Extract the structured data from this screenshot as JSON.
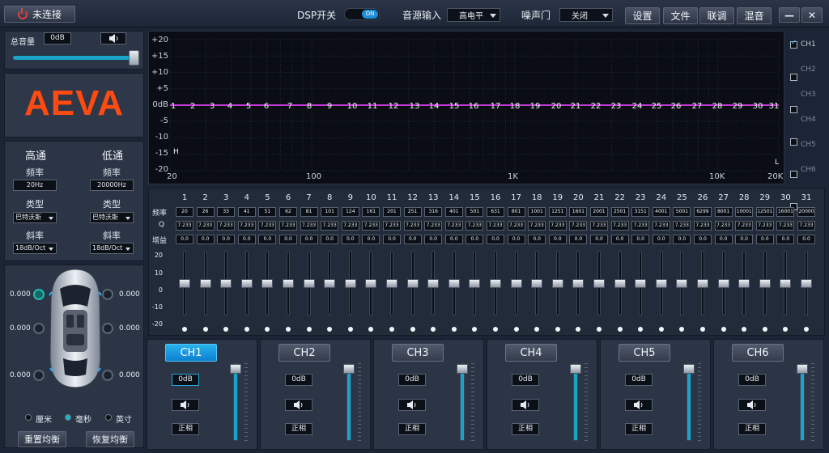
{
  "topbar": {
    "connect": "未连接",
    "dsp_label": "DSP开关",
    "dsp_toggle": "ON",
    "src_label": "音源输入",
    "src_value": "高电平",
    "gate_label": "噪声门",
    "gate_value": "关闭",
    "buttons": [
      "设置",
      "文件",
      "联调",
      "混音"
    ],
    "min": "—",
    "close": "✕"
  },
  "volume": {
    "label": "总音量",
    "value": "0dB",
    "level": 0.95
  },
  "logo": "AEVA",
  "crossover": {
    "high": {
      "title": "高通",
      "freq_label": "频率",
      "freq": "20Hz",
      "type_label": "类型",
      "type": "巴特沃斯",
      "slope_label": "斜率",
      "slope": "18dB/Oct"
    },
    "low": {
      "title": "低通",
      "freq_label": "频率",
      "freq": "20000Hz",
      "type_label": "类型",
      "type": "巴特沃斯",
      "slope_label": "斜率",
      "slope": "18dB/Oct"
    }
  },
  "speakers": {
    "left": [
      "0.000",
      "0.000",
      "0.000"
    ],
    "right": [
      "0.000",
      "0.000",
      "0.000"
    ],
    "units": [
      "厘米",
      "毫秒",
      "英寸"
    ],
    "unit_selected": 1,
    "reset": "重置均衡",
    "restore": "恢复均衡"
  },
  "graph": {
    "y_labels": [
      "+20",
      "+15",
      "+10",
      "+5",
      "0dB",
      "-5",
      "-10",
      "-15",
      "-20"
    ],
    "x_labels": [
      "20",
      "100",
      "1K",
      "10K",
      "20K"
    ],
    "band_markers": [
      "1",
      "2",
      "3",
      "4",
      "5",
      "6",
      "7",
      "8",
      "9",
      "10",
      "11",
      "12",
      "13",
      "14",
      "15",
      "16",
      "17",
      "18",
      "19",
      "20",
      "21",
      "22",
      "23",
      "24",
      "25",
      "26",
      "27",
      "28",
      "29",
      "30",
      "31"
    ],
    "hp_marker": "H",
    "lp_marker": "L"
  },
  "channel_list": [
    {
      "label": "CH1",
      "checked": true
    },
    {
      "label": "CH2",
      "checked": false
    },
    {
      "label": "CH3",
      "checked": false
    },
    {
      "label": "CH4",
      "checked": false
    },
    {
      "label": "CH5",
      "checked": false
    },
    {
      "label": "CH6",
      "checked": false
    }
  ],
  "eq": {
    "row_labels": {
      "freq": "频率",
      "q": "Q",
      "gain": "增益"
    },
    "scale": [
      "20",
      "10",
      "0",
      "-10",
      "-20"
    ],
    "bands": [
      {
        "n": "1",
        "f": "20",
        "q": "7.233",
        "g": "0.0"
      },
      {
        "n": "2",
        "f": "26",
        "q": "7.233",
        "g": "0.0"
      },
      {
        "n": "3",
        "f": "33",
        "q": "7.233",
        "g": "0.0"
      },
      {
        "n": "4",
        "f": "41",
        "q": "7.233",
        "g": "0.0"
      },
      {
        "n": "5",
        "f": "51",
        "q": "7.233",
        "g": "0.0"
      },
      {
        "n": "6",
        "f": "62",
        "q": "7.233",
        "g": "0.0"
      },
      {
        "n": "7",
        "f": "81",
        "q": "7.233",
        "g": "0.0"
      },
      {
        "n": "8",
        "f": "101",
        "q": "7.233",
        "g": "0.0"
      },
      {
        "n": "9",
        "f": "124",
        "q": "7.233",
        "g": "0.0"
      },
      {
        "n": "10",
        "f": "161",
        "q": "7.233",
        "g": "0.0"
      },
      {
        "n": "11",
        "f": "201",
        "q": "7.233",
        "g": "0.0"
      },
      {
        "n": "12",
        "f": "251",
        "q": "7.233",
        "g": "0.0"
      },
      {
        "n": "13",
        "f": "316",
        "q": "7.233",
        "g": "0.0"
      },
      {
        "n": "14",
        "f": "401",
        "q": "7.233",
        "g": "0.0"
      },
      {
        "n": "15",
        "f": "501",
        "q": "7.233",
        "g": "0.0"
      },
      {
        "n": "16",
        "f": "631",
        "q": "7.233",
        "g": "0.0"
      },
      {
        "n": "17",
        "f": "801",
        "q": "7.233",
        "g": "0.0"
      },
      {
        "n": "18",
        "f": "1001",
        "q": "7.233",
        "g": "0.0"
      },
      {
        "n": "19",
        "f": "1251",
        "q": "7.233",
        "g": "0.0"
      },
      {
        "n": "20",
        "f": "1601",
        "q": "7.233",
        "g": "0.0"
      },
      {
        "n": "21",
        "f": "2001",
        "q": "7.233",
        "g": "0.0"
      },
      {
        "n": "22",
        "f": "2501",
        "q": "7.233",
        "g": "0.0"
      },
      {
        "n": "23",
        "f": "3151",
        "q": "7.233",
        "g": "0.0"
      },
      {
        "n": "24",
        "f": "4001",
        "q": "7.233",
        "g": "0.0"
      },
      {
        "n": "25",
        "f": "5001",
        "q": "7.233",
        "g": "0.0"
      },
      {
        "n": "26",
        "f": "6299",
        "q": "7.233",
        "g": "0.0"
      },
      {
        "n": "27",
        "f": "8001",
        "q": "7.233",
        "g": "0.0"
      },
      {
        "n": "28",
        "f": "10001",
        "q": "7.233",
        "g": "0.0"
      },
      {
        "n": "29",
        "f": "12501",
        "q": "7.233",
        "g": "0.0"
      },
      {
        "n": "30",
        "f": "16001",
        "q": "7.233",
        "g": "0.0"
      },
      {
        "n": "31",
        "f": "20000",
        "q": "7.233",
        "g": "0.0"
      }
    ]
  },
  "channels": [
    {
      "label": "CH1",
      "gain": "0dB",
      "phase": "正相",
      "level": 0.95,
      "active": true
    },
    {
      "label": "CH2",
      "gain": "0dB",
      "phase": "正相",
      "level": 0.95,
      "active": false
    },
    {
      "label": "CH3",
      "gain": "0dB",
      "phase": "正相",
      "level": 0.95,
      "active": false
    },
    {
      "label": "CH4",
      "gain": "0dB",
      "phase": "正相",
      "level": 0.95,
      "active": false
    },
    {
      "label": "CH5",
      "gain": "0dB",
      "phase": "正相",
      "level": 0.95,
      "active": false
    },
    {
      "label": "CH6",
      "gain": "0dB",
      "phase": "正相",
      "level": 0.95,
      "active": false
    }
  ],
  "colors": {
    "accent": "#1aa3c9",
    "logo": "#ff4a10",
    "curve": "#c23bd4"
  }
}
